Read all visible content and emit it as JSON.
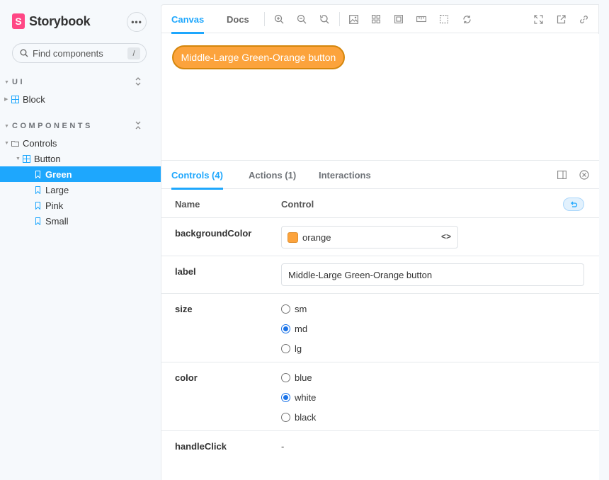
{
  "sidebar": {
    "brand": "Storybook",
    "brand_logo_letter": "S",
    "menu_label": "•••",
    "search_placeholder": "Find components",
    "search_shortcut": "/",
    "sections": [
      {
        "title": "UI",
        "items": [
          {
            "label": "Block"
          }
        ]
      },
      {
        "title": "COMPONENTS"
      }
    ],
    "tree": {
      "group": "Controls",
      "component": "Button",
      "stories": [
        "Green",
        "Large",
        "Pink",
        "Small"
      ],
      "selected": "Green"
    }
  },
  "toolbar": {
    "tabs": [
      "Canvas",
      "Docs"
    ],
    "active_tab": "Canvas",
    "icons": [
      "zoom-in-icon",
      "zoom-out-icon",
      "zoom-reset-icon",
      "background-icon",
      "grid-icon",
      "outline-icon",
      "measure-icon",
      "viewport-icon",
      "remount-icon",
      "fullscreen-icon",
      "open-new-tab-icon",
      "copy-link-icon"
    ]
  },
  "canvas": {
    "button_label": "Middle-Large Green-Orange button",
    "button_color": "#fca33c"
  },
  "addons": {
    "tabs": [
      "Controls (4)",
      "Actions (1)",
      "Interactions"
    ],
    "active_tab": "Controls (4)",
    "table_headers": {
      "name": "Name",
      "control": "Control"
    },
    "rows": {
      "backgroundColor": {
        "name": "backgroundColor",
        "value": "orange",
        "swatch": "#fca33c",
        "code_toggle": "<>"
      },
      "label": {
        "name": "label",
        "value": "Middle-Large Green-Orange button"
      },
      "size": {
        "name": "size",
        "options": [
          "sm",
          "md",
          "lg"
        ],
        "selected": "md"
      },
      "color": {
        "name": "color",
        "options": [
          "blue",
          "white",
          "black"
        ],
        "selected": "white"
      },
      "handleClick": {
        "name": "handleClick",
        "value": "-"
      }
    }
  },
  "colors": {
    "accent": "#1ea7fd",
    "brand": "#ff4785",
    "sidebar_bg": "#f6f9fc"
  }
}
